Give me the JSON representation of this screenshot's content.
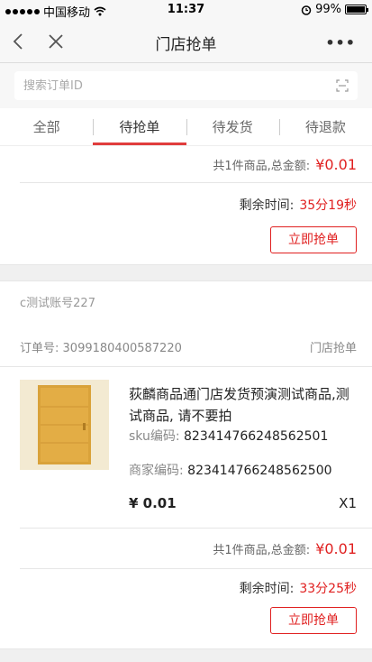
{
  "status": {
    "carrier": "中国移动",
    "time": "11:37",
    "battery": "99%",
    "battery_level": 0.99
  },
  "nav": {
    "title": "门店抢单",
    "more": "•••"
  },
  "search": {
    "placeholder": "搜索订单ID",
    "value": ""
  },
  "tabs": [
    {
      "label": "全部"
    },
    {
      "label": "待抢单",
      "active": true
    },
    {
      "label": "待发货"
    },
    {
      "label": "待退款"
    }
  ],
  "orders": [
    {
      "total_label": "共1件商品,总金额:",
      "total_amount": "¥0.01",
      "remain_label": "剩余时间:",
      "remain_time": "35分19秒",
      "action": "立即抢单"
    },
    {
      "account": "c测试账号227",
      "order_no_label": "订单号:",
      "order_no": "3099180400587220",
      "order_type": "门店抢单",
      "product_name": "荻麟商品通门店发货预演测试商品,测试商品, 请不要拍",
      "sku_label": "sku编码:",
      "sku": "823414766248562501",
      "merchant_label": "商家编码:",
      "merchant_code": "823414766248562500",
      "price": "¥ 0.01",
      "qty": "X1",
      "total_label": "共1件商品,总金额:",
      "total_amount": "¥0.01",
      "remain_label": "剩余时间:",
      "remain_time": "33分25秒",
      "action": "立即抢单"
    }
  ],
  "colors": {
    "accent": "#e02020",
    "tab_indicator": "#e03c3c"
  }
}
